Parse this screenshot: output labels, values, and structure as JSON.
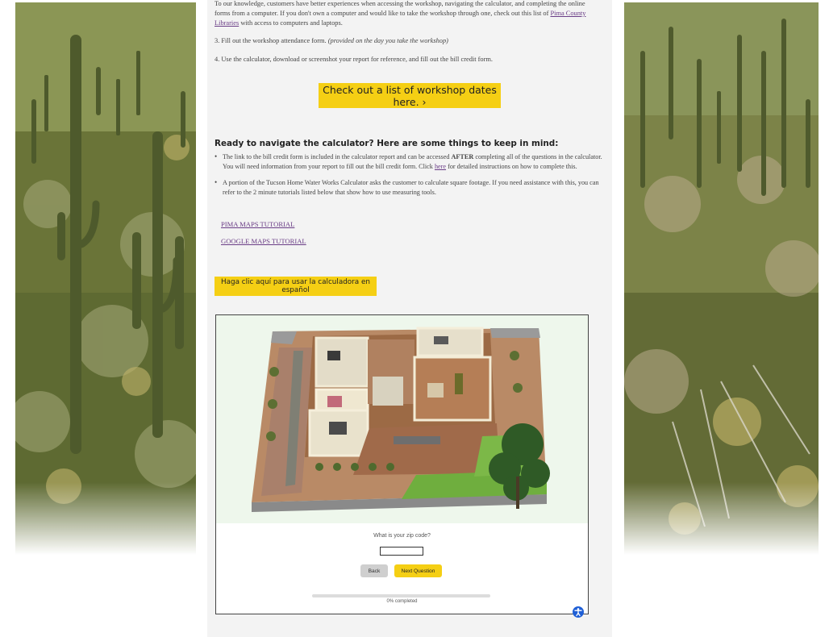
{
  "intro": {
    "para_start": "To our knowledge, customers have better experiences when accessing the workshop, navigating the calculator, and completing the online forms from a computer. If you don't own a computer and would like to take the workshop through one, check out this list of ",
    "para_link": "Pima County Libraries",
    "para_end": " with access to computers and laptops."
  },
  "steps": {
    "step3_text": "3. Fill out the workshop attendance form. ",
    "step3_note": "(provided on the day you take the workshop)",
    "step4_text": "4. Use the calculator, download or screenshot your report for reference, and fill out the bill credit form."
  },
  "workshop_button": {
    "label": "Check out a list of workshop dates here.  ›"
  },
  "tips": {
    "heading": "Ready to navigate the calculator? Here are some things to keep in mind:",
    "bullet1_a": "The link to the bill credit form is included in the calculator report and can be accessed ",
    "bullet1_bold": "AFTER",
    "bullet1_b": " completing all of the questions in the calculator. You will need information from your report to fill out the bill credit form. Click ",
    "bullet1_link": "here",
    "bullet1_c": " for detailed instructions on how to complete this.",
    "bullet2": " A portion of the Tucson Home Water Works Calculator asks the customer to calculate square footage. If you need assistance with this, you can refer to the 2 minute tutorials listed below that show how to use measuring tools."
  },
  "tutorials": {
    "pima_maps": "PIMA MAPS TUTORIAL",
    "google_maps": "GOOGLE MAPS TUTORIAL"
  },
  "spanish_button": {
    "label": "Haga clic aquí para usar la calculadora en español"
  },
  "calculator": {
    "question": "What is your zip code?",
    "zip_value": "",
    "back_label": "Back",
    "next_label": "Next Question",
    "progress_percent": 0,
    "progress_text": "0% completed"
  },
  "colors": {
    "accent_yellow": "#f5cf14",
    "link_purple": "#6a3d86",
    "panel_gray": "#f3f3f3",
    "accessibility_blue": "#1f5fd6"
  },
  "icons": {
    "accessibility": "accessibility-icon",
    "chevron": "chevron-right-icon"
  }
}
